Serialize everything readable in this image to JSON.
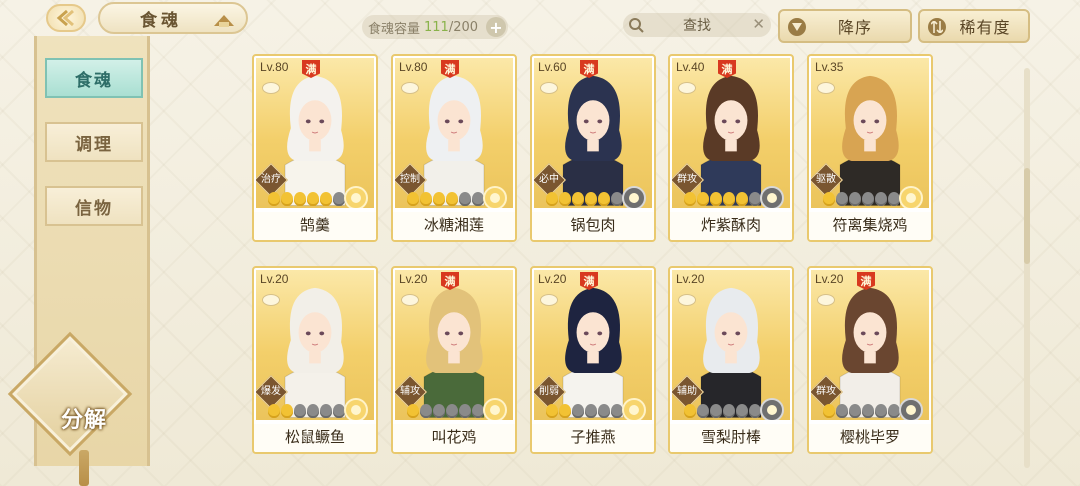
{
  "header": {
    "title": "食魂",
    "capacity_label": "食魂容量",
    "capacity_current": "111",
    "capacity_max": "/200",
    "capacity_plus": "+",
    "search_placeholder": "查找",
    "search_clear": "✕",
    "sort_order_label": "降序",
    "sort_key_label": "稀有度"
  },
  "sidebar": {
    "tabs": [
      {
        "label": "食魂",
        "active": true
      },
      {
        "label": "调理",
        "active": false
      },
      {
        "label": "信物",
        "active": false
      }
    ],
    "decompose_label": "分解"
  },
  "colors": {
    "accent_gold": "#e9c96e",
    "active_tab": "#a9dfd2",
    "max_badge": "#d8391f",
    "capacity_current": "#89b24a"
  },
  "cards": [
    {
      "level": "Lv.80",
      "max": "满",
      "role": "治疗",
      "stars_on": 5,
      "stars_total": 6,
      "element": "gold",
      "name": "鹄羹",
      "hair": "#f4f2ee",
      "outfit": "#f7f4ec"
    },
    {
      "level": "Lv.80",
      "max": "满",
      "role": "控制",
      "stars_on": 4,
      "stars_total": 6,
      "element": "gold",
      "name": "冰糖湘莲",
      "hair": "#eef0f2",
      "outfit": "#f2f0ea"
    },
    {
      "level": "Lv.60",
      "max": "满",
      "role": "必中",
      "stars_on": 5,
      "stars_total": 6,
      "element": "dark",
      "name": "锅包肉",
      "hair": "#2b3350",
      "outfit": "#2a2f45"
    },
    {
      "level": "Lv.40",
      "max": "满",
      "role": "群攻",
      "stars_on": 5,
      "stars_total": 6,
      "element": "dark",
      "name": "炸紫酥肉",
      "hair": "#5a3a26",
      "outfit": "#2f3a5a"
    },
    {
      "level": "Lv.35",
      "max": "",
      "role": "驱散",
      "stars_on": 1,
      "stars_total": 6,
      "element": "gold",
      "name": "符离集烧鸡",
      "hair": "#d8a452",
      "outfit": "#2e2a26"
    },
    {
      "level": "Lv.20",
      "max": "",
      "role": "爆发",
      "stars_on": 2,
      "stars_total": 6,
      "element": "gold",
      "name": "松鼠鳜鱼",
      "hair": "#f2efe8",
      "outfit": "#f4f1ea"
    },
    {
      "level": "Lv.20",
      "max": "满",
      "role": "辅攻",
      "stars_on": 1,
      "stars_total": 6,
      "element": "gold",
      "name": "叫花鸡",
      "hair": "#e2c27a",
      "outfit": "#4a6a3a"
    },
    {
      "level": "Lv.20",
      "max": "满",
      "role": "削弱",
      "stars_on": 2,
      "stars_total": 6,
      "element": "gold",
      "name": "子推燕",
      "hair": "#1e2440",
      "outfit": "#f5f3ee"
    },
    {
      "level": "Lv.20",
      "max": "",
      "role": "辅助",
      "stars_on": 1,
      "stars_total": 6,
      "element": "dark",
      "name": "雪梨肘棒",
      "hair": "#e8ebee",
      "outfit": "#26262a"
    },
    {
      "level": "Lv.20",
      "max": "满",
      "role": "群攻",
      "stars_on": 1,
      "stars_total": 6,
      "element": "dark",
      "name": "樱桃毕罗",
      "hair": "#6a4630",
      "outfit": "#f2eee8"
    }
  ]
}
